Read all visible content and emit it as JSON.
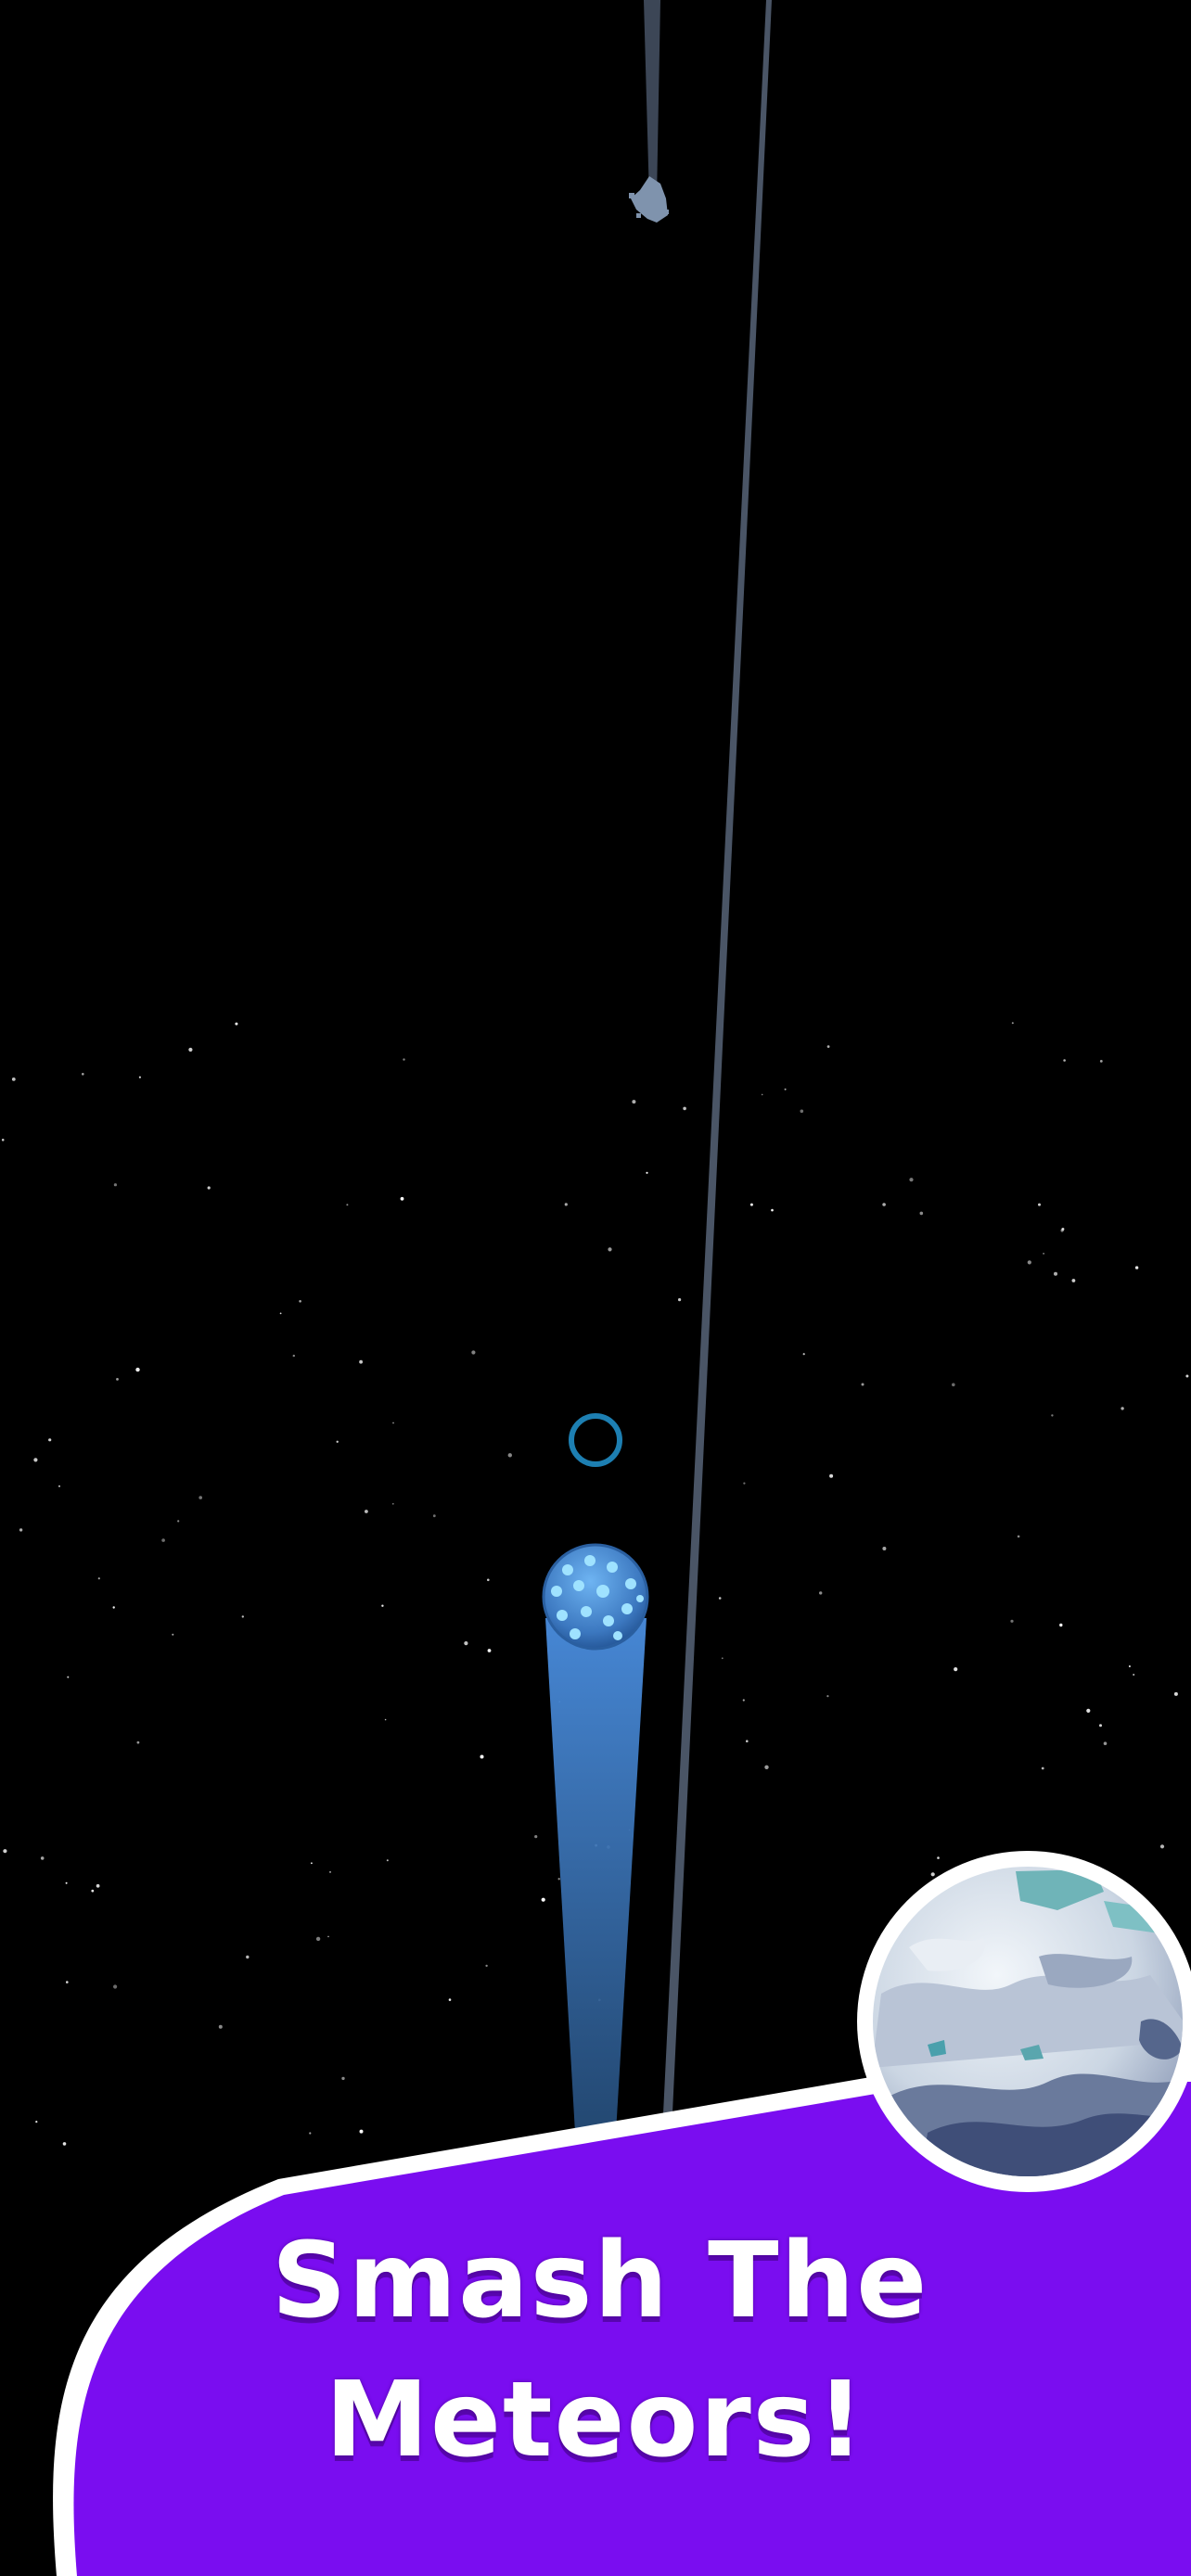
{
  "promo": {
    "line1": "Smash The",
    "line2": "Meteors!"
  },
  "colors": {
    "background": "#000000",
    "banner": "#7a0df0",
    "banner_border": "#ffffff",
    "trail": "#3f7ac2",
    "target_ring": "#1d7fb2",
    "ball": "#4a8ed8",
    "ball_spots": "#9fe2ff",
    "track_line": "#4a5566",
    "planet": "#dfe6ee"
  },
  "icons": {
    "player_ball": "glowing-spotted-ball",
    "target": "aim-ring",
    "planet": "ice-planet",
    "meteor": "meteor-debris"
  }
}
